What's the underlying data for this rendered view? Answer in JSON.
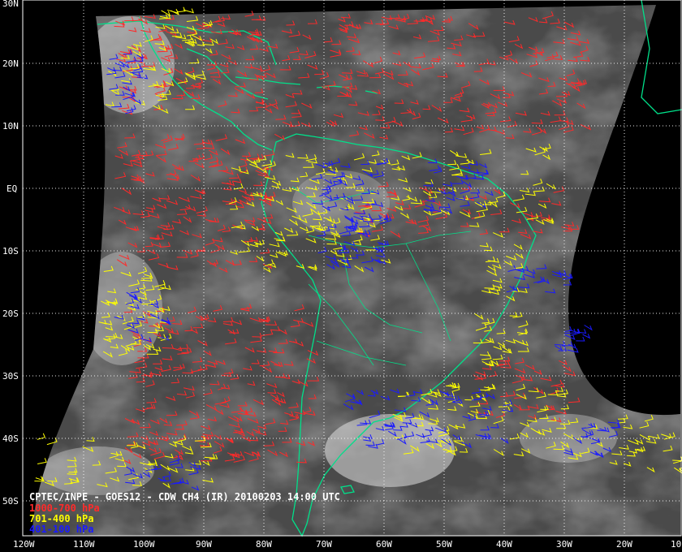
{
  "caption": {
    "title": "CPTEC/INPE - GOES12 - CDW CH4 (IR) 20100203 14:00 UTC",
    "layers": [
      {
        "label": "1000-700 hPa",
        "color": "#ff2a2a"
      },
      {
        "label": "701-400 hPa",
        "color": "#ffff00"
      },
      {
        "label": "401-100 hPa",
        "color": "#1a1aff"
      }
    ]
  },
  "lat_labels": [
    "30N",
    "20N",
    "10N",
    "EQ",
    "10S",
    "20S",
    "30S",
    "40S",
    "50S"
  ],
  "lon_labels": [
    "120W",
    "110W",
    "100W",
    "90W",
    "80W",
    "70W",
    "60W",
    "50W",
    "40W",
    "30W",
    "20W",
    "10"
  ],
  "colors": {
    "coast": "#00e08a",
    "grid": "#ffffff",
    "background": "#000000",
    "cloud_dark": "#3a3a3a",
    "cloud_light": "#d8d8d8"
  }
}
